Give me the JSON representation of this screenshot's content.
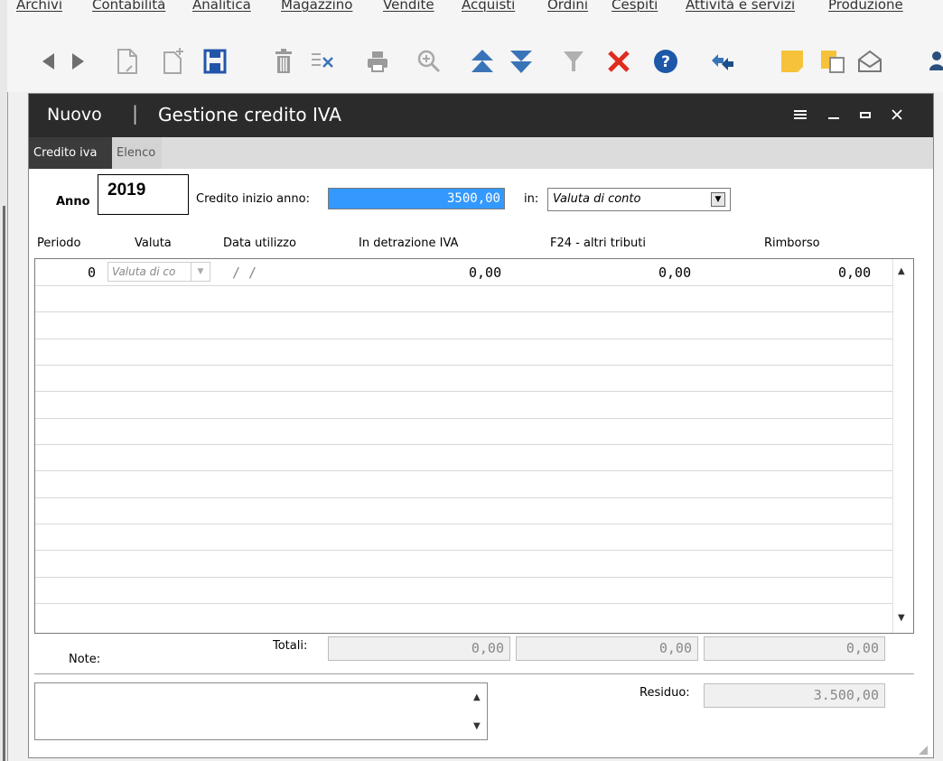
{
  "menu": [
    "Archivi",
    "Contabilità",
    "Analitica",
    "Magazzino",
    "Vendite",
    "Acquisti",
    "Ordini",
    "Cespiti",
    "Attività e servizi",
    "Produzione"
  ],
  "toolbar_icons": [
    "back-icon",
    "forward-icon",
    "edit-doc-icon",
    "new-doc-icon",
    "save-icon",
    "delete-icon",
    "delete-row-icon",
    "print-icon",
    "zoom-icon",
    "move-up-icon",
    "move-down-icon",
    "filter-icon",
    "cancel-icon",
    "help-icon",
    "process-icon",
    "note-icon",
    "folders-icon",
    "mail-icon"
  ],
  "colors": {
    "titlebar": "#2b2b2b",
    "selection": "#3399ff",
    "save": "#2255aa",
    "arrow": "#3a74b8",
    "cancel": "#e02b1f",
    "help": "#1d58a8",
    "notes": "#f5c23a"
  },
  "window": {
    "mode": "Nuovo",
    "separator": "|",
    "title": "Gestione credito IVA"
  },
  "tabs": [
    {
      "label": "Credito iva"
    },
    {
      "label": "Elenco"
    }
  ],
  "form": {
    "anno_label": "Anno",
    "anno_value": "2019",
    "credito_label": "Credito inizio anno:",
    "credito_value": "3500,00",
    "in_label": "in:",
    "in_value": "Valuta di conto"
  },
  "grid": {
    "columns": [
      "Periodo",
      "Valuta",
      "Data utilizzo",
      "In detrazione IVA",
      "F24 - altri tributi",
      "Rimborso"
    ],
    "rows": [
      {
        "periodo": "0",
        "valuta": "Valuta di co",
        "data": "/  /",
        "detrazione": "0,00",
        "f24": "0,00",
        "rimborso": "0,00"
      }
    ]
  },
  "totals": {
    "label": "Totali:",
    "detrazione": "0,00",
    "f24": "0,00",
    "rimborso": "0,00"
  },
  "notes": {
    "label": "Note:"
  },
  "residuo": {
    "label": "Residuo:",
    "value": "3.500,00"
  }
}
